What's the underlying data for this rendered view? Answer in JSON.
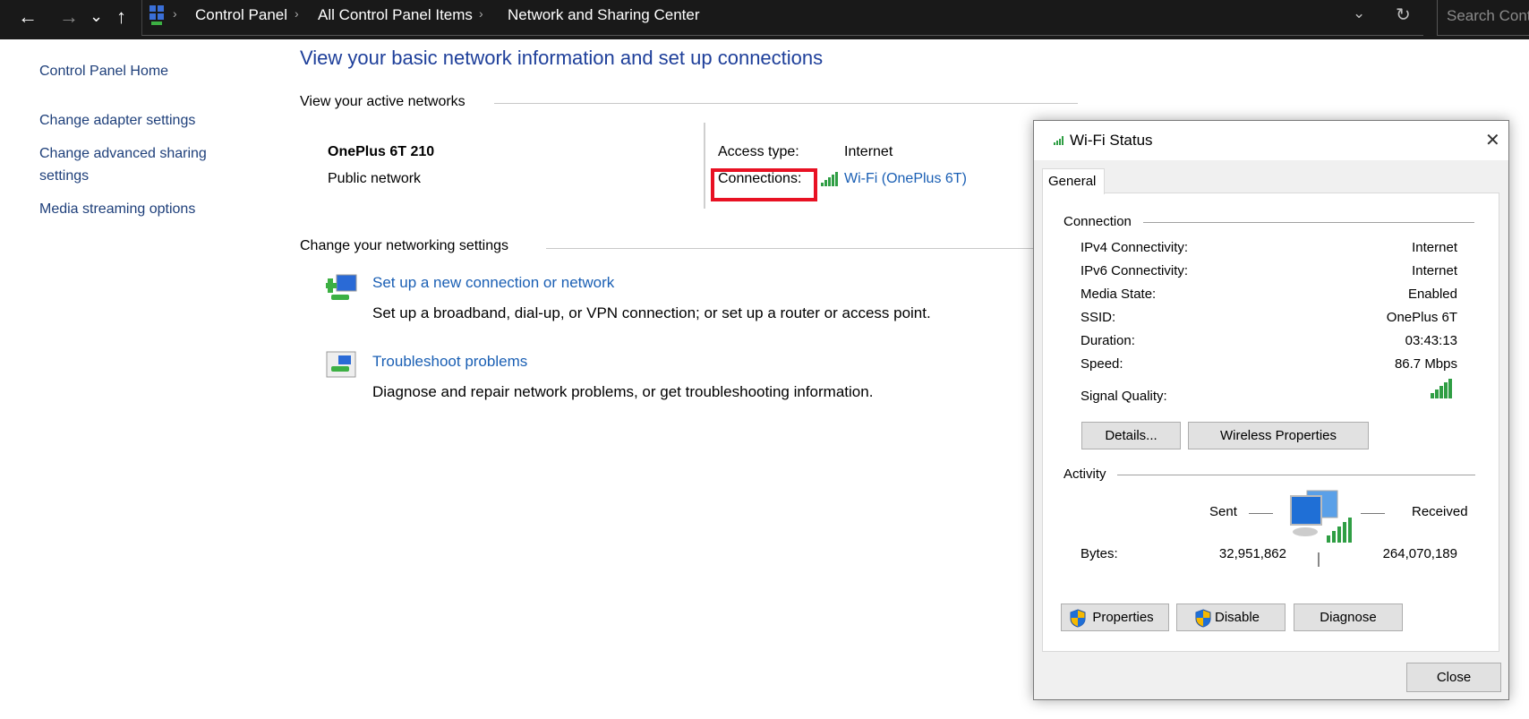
{
  "addressbar": {
    "nav": {
      "back": "←",
      "forward": "→",
      "recent": "⌄",
      "up": "↑"
    },
    "breadcrumb": [
      "Control Panel",
      "All Control Panel Items",
      "Network and Sharing Center"
    ],
    "search_placeholder": "Search Cont",
    "refresh": "↻",
    "dropdown": "⌄"
  },
  "sidebar": {
    "items": [
      {
        "label": "Control Panel Home"
      },
      {
        "label": "Change adapter settings"
      },
      {
        "label": "Change advanced sharing"
      },
      {
        "label": "settings"
      },
      {
        "label": "Media streaming options"
      }
    ]
  },
  "main": {
    "title": "View your basic network information and set up connections",
    "active_networks_heading": "View your active networks",
    "network": {
      "name": "OnePlus 6T 210",
      "type": "Public network",
      "access_type_label": "Access type:",
      "access_type_value": "Internet",
      "connections_label": "Connections:",
      "connections_value": "Wi-Fi (OnePlus 6T)"
    },
    "settings_heading": "Change your networking settings",
    "tasks": [
      {
        "link": "Set up a new connection or network",
        "desc": "Set up a broadband, dial-up, or VPN connection; or set up a router or access point."
      },
      {
        "link": "Troubleshoot problems",
        "desc": "Diagnose and repair network problems, or get troubleshooting information."
      }
    ],
    "highlight_color": "#e81123",
    "link_color": "#1a5fb4"
  },
  "dialog": {
    "title": "Wi-Fi Status",
    "close": "✕",
    "tab": "General",
    "connection_heading": "Connection",
    "rows": [
      {
        "label": "IPv4 Connectivity:",
        "value": "Internet"
      },
      {
        "label": "IPv6 Connectivity:",
        "value": "Internet"
      },
      {
        "label": "Media State:",
        "value": "Enabled"
      },
      {
        "label": "SSID:",
        "value": "OnePlus 6T"
      },
      {
        "label": "Duration:",
        "value": "03:43:13"
      },
      {
        "label": "Speed:",
        "value": "86.7 Mbps"
      }
    ],
    "signal_label": "Signal Quality:",
    "signal_bars": 5,
    "details_button": "Details...",
    "wireless_button": "Wireless Properties",
    "activity_heading": "Activity",
    "sent_label": "Sent",
    "received_label": "Received",
    "bytes_label": "Bytes:",
    "bytes_sent": "32,951,862",
    "bytes_received": "264,070,189",
    "properties_button": "Properties",
    "disable_button": "Disable",
    "diagnose_button": "Diagnose",
    "close_button": "Close"
  }
}
